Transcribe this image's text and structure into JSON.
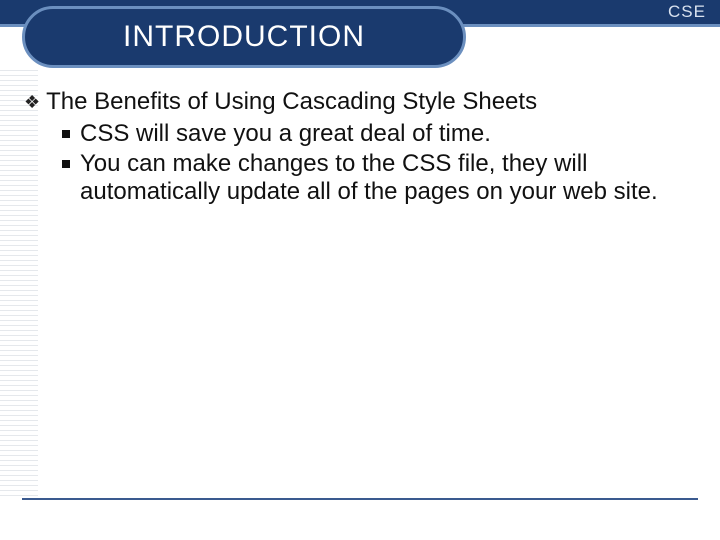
{
  "header": {
    "corner_label": "CSE",
    "title": "INTRODUCTION"
  },
  "content": {
    "heading": "The Benefits of Using Cascading Style Sheets",
    "bullets": [
      "CSS will save you a great deal of time.",
      "You can make changes to the CSS file, they will automatically update all of the pages on your web site."
    ]
  }
}
